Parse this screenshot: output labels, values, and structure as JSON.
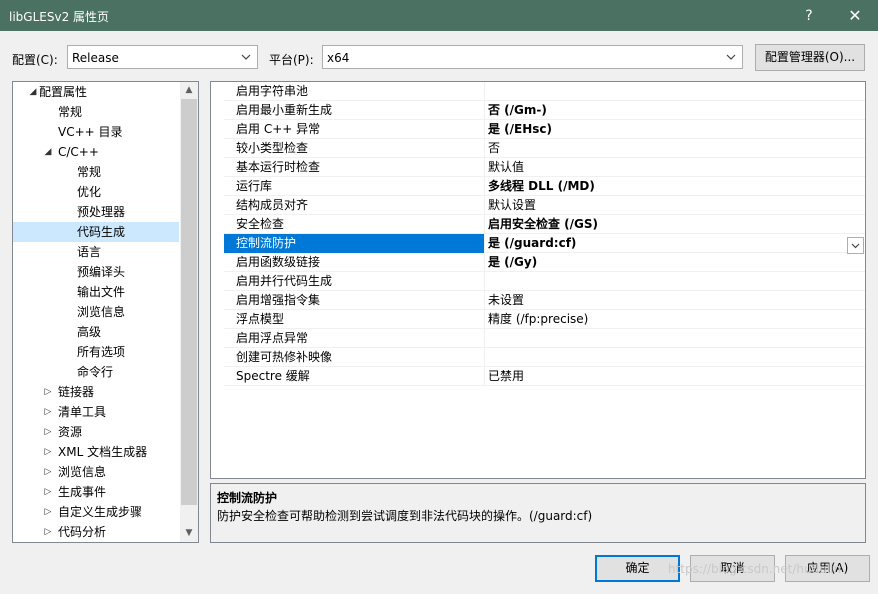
{
  "window": {
    "title": "libGLESv2 属性页",
    "help_glyph": "?",
    "close_glyph": "✕"
  },
  "toolbar": {
    "config_label": "配置(C):",
    "config_value": "Release",
    "platform_label": "平台(P):",
    "platform_value": "x64",
    "config_manager_label": "配置管理器(O)..."
  },
  "tree": {
    "items": [
      {
        "label": "配置属性",
        "expander": "◢"
      },
      {
        "label": "常规",
        "expander": ""
      },
      {
        "label": "VC++ 目录",
        "expander": ""
      },
      {
        "label": "C/C++",
        "expander": "◢"
      },
      {
        "label": "常规",
        "expander": ""
      },
      {
        "label": "优化",
        "expander": ""
      },
      {
        "label": "预处理器",
        "expander": ""
      },
      {
        "label": "代码生成",
        "expander": "",
        "selected": true
      },
      {
        "label": "语言",
        "expander": ""
      },
      {
        "label": "预编译头",
        "expander": ""
      },
      {
        "label": "输出文件",
        "expander": ""
      },
      {
        "label": "浏览信息",
        "expander": ""
      },
      {
        "label": "高级",
        "expander": ""
      },
      {
        "label": "所有选项",
        "expander": ""
      },
      {
        "label": "命令行",
        "expander": ""
      },
      {
        "label": "链接器",
        "expander": "▷"
      },
      {
        "label": "清单工具",
        "expander": "▷"
      },
      {
        "label": "资源",
        "expander": "▷"
      },
      {
        "label": "XML 文档生成器",
        "expander": "▷"
      },
      {
        "label": "浏览信息",
        "expander": "▷"
      },
      {
        "label": "生成事件",
        "expander": "▷"
      },
      {
        "label": "自定义生成步骤",
        "expander": "▷"
      },
      {
        "label": "代码分析",
        "expander": "▷"
      }
    ],
    "scroll_up_glyph": "▲",
    "scroll_down_glyph": "▼"
  },
  "grid": {
    "rows": [
      {
        "name": "启用字符串池",
        "value": "",
        "bold": false
      },
      {
        "name": "启用最小重新生成",
        "value": "否 (/Gm-)",
        "bold": true
      },
      {
        "name": "启用 C++ 异常",
        "value": "是 (/EHsc)",
        "bold": true
      },
      {
        "name": "较小类型检查",
        "value": "否",
        "bold": false
      },
      {
        "name": "基本运行时检查",
        "value": "默认值",
        "bold": false
      },
      {
        "name": "运行库",
        "value": "多线程 DLL (/MD)",
        "bold": true
      },
      {
        "name": "结构成员对齐",
        "value": "默认设置",
        "bold": false
      },
      {
        "name": "安全检查",
        "value": "启用安全检查 (/GS)",
        "bold": true
      },
      {
        "name": "控制流防护",
        "value": "是 (/guard:cf)",
        "bold": true,
        "selected": true
      },
      {
        "name": "启用函数级链接",
        "value": "是 (/Gy)",
        "bold": true
      },
      {
        "name": "启用并行代码生成",
        "value": "",
        "bold": false
      },
      {
        "name": "启用增强指令集",
        "value": "未设置",
        "bold": false
      },
      {
        "name": "浮点模型",
        "value": "精度 (/fp:precise)",
        "bold": false
      },
      {
        "name": "启用浮点异常",
        "value": "",
        "bold": false
      },
      {
        "name": "创建可热修补映像",
        "value": "",
        "bold": false
      },
      {
        "name": "Spectre 缓解",
        "value": "已禁用",
        "bold": false
      }
    ]
  },
  "description": {
    "title": "控制流防护",
    "text": "防护安全检查可帮助检测到尝试调度到非法代码块的操作。(/guard:cf)"
  },
  "buttons": {
    "ok": "确定",
    "cancel": "取消",
    "apply": "应用(A)"
  },
  "watermark": "https://blog.csdn.net/hudulin"
}
